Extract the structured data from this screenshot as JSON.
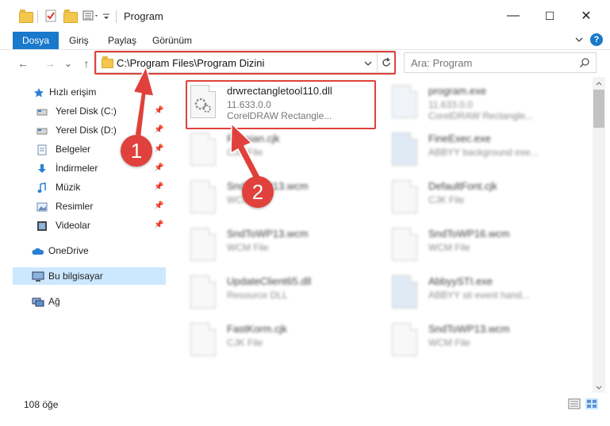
{
  "window": {
    "title": "Program",
    "minimize_glyph": "—",
    "maximize_glyph": "☐",
    "close_glyph": "✕"
  },
  "ribbon": {
    "tabs": [
      {
        "label": "Dosya",
        "active": true
      },
      {
        "label": "Giriş"
      },
      {
        "label": "Paylaş"
      },
      {
        "label": "Görünüm"
      }
    ],
    "help_glyph": "?"
  },
  "navigation": {
    "back_glyph": "←",
    "forward_glyph": "→",
    "recent_glyph": "⌄",
    "up_glyph": "↑",
    "address_value": "C:\\Program Files\\Program Dizini",
    "search_placeholder": "Ara: Program"
  },
  "sidebar": {
    "items": [
      {
        "label": "Hızlı erişim",
        "icon": "star-icon"
      },
      {
        "label": "Yerel Disk (C:)",
        "icon": "drive-icon",
        "pinned": true
      },
      {
        "label": "Yerel Disk (D:)",
        "icon": "drive-icon",
        "pinned": true
      },
      {
        "label": "Belgeler",
        "icon": "documents-icon",
        "pinned": true
      },
      {
        "label": "İndirmeler",
        "icon": "download-icon",
        "pinned": true
      },
      {
        "label": "Müzik",
        "icon": "music-icon",
        "pinned": true
      },
      {
        "label": "Resimler",
        "icon": "pictures-icon",
        "pinned": true
      },
      {
        "label": "Videolar",
        "icon": "videos-icon",
        "pinned": true
      },
      {
        "label": "OneDrive",
        "icon": "cloud-icon"
      },
      {
        "label": "Bu bilgisayar",
        "icon": "computer-icon",
        "selected": true
      },
      {
        "label": "Ağ",
        "icon": "network-icon"
      }
    ]
  },
  "files": [
    {
      "name": "drwrectangletool110.dll",
      "line2": "11.633.0.0",
      "line3": "CorelDRAW Rectangle...",
      "highlighted": true
    },
    {
      "name": "program.exe",
      "line2": "11.633.0.0",
      "line3": "CorelDRAW Rectangle..."
    },
    {
      "name": "Russian.cjk",
      "line2": "CJK File",
      "line3": ""
    },
    {
      "name": "FineExec.exe",
      "line2": "ABBYY background exe...",
      "line3": ""
    },
    {
      "name": "SndToWP13.wcm",
      "line2": "WCM File",
      "line3": ""
    },
    {
      "name": "DefaultFont.cjk",
      "line2": "CJK File",
      "line3": ""
    },
    {
      "name": "SndToWP13.wcm",
      "line2": "WCM File",
      "line3": ""
    },
    {
      "name": "SndToWP16.wcm",
      "line2": "WCM File",
      "line3": ""
    },
    {
      "name": "UpdateClient65.dll",
      "line2": "Resource DLL",
      "line3": ""
    },
    {
      "name": "AbbyySTI.exe",
      "line2": "ABBYY sti event hand...",
      "line3": ""
    },
    {
      "name": "FastKorm.cjk",
      "line2": "CJK File",
      "line3": ""
    },
    {
      "name": "SndToWP13.wcm",
      "line2": "WCM File",
      "line3": ""
    }
  ],
  "annotations": {
    "marker_1": "1",
    "marker_2": "2",
    "highlight_color": "#e0413c"
  },
  "status": {
    "item_count": "108 öğe"
  },
  "colors": {
    "accent": "#1979ca",
    "selection": "#cce8ff"
  }
}
